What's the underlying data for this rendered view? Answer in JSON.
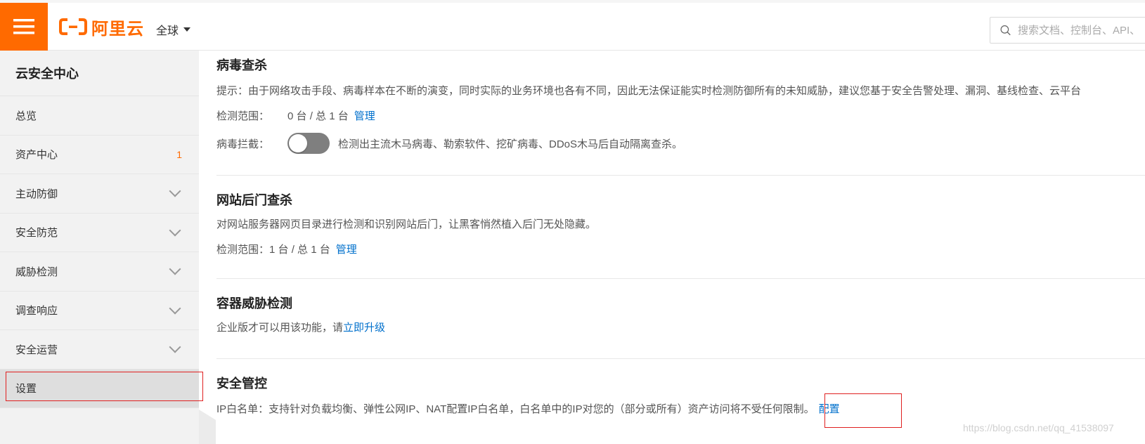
{
  "header": {
    "logo_text": "阿里云",
    "region": "全球",
    "search_placeholder": "搜索文档、控制台、API、"
  },
  "sidebar": {
    "title": "云安全中心",
    "items": [
      {
        "label": "总览",
        "expandable": false
      },
      {
        "label": "资产中心",
        "count": "1",
        "expandable": false
      },
      {
        "label": "主动防御",
        "expandable": true
      },
      {
        "label": "安全防范",
        "expandable": true
      },
      {
        "label": "威胁检测",
        "expandable": true
      },
      {
        "label": "调查响应",
        "expandable": true
      },
      {
        "label": "安全运营",
        "expandable": true
      },
      {
        "label": "设置",
        "expandable": false,
        "active": true
      }
    ]
  },
  "main": {
    "virus": {
      "title": "病毒查杀",
      "tip": "提示：由于网络攻击手段、病毒样本在不断的演变，同时实际的业务环境也各有不同，因此无法保证能实时检测防御所有的未知威胁，建议您基于安全告警处理、漏洞、基线检查、云平台",
      "scope_label": "检测范围：",
      "scope_value": "0 台 / 总 1 台",
      "scope_link": "管理",
      "block_label": "病毒拦截：",
      "block_toggle": "off",
      "block_desc": "检测出主流木马病毒、勒索软件、挖矿病毒、DDoS木马后自动隔离查杀。"
    },
    "webshell": {
      "title": "网站后门查杀",
      "desc": "对网站服务器网页目录进行检测和识别网站后门，让黑客悄然植入后门无处隐藏。",
      "scope_label": "检测范围：",
      "scope_value": "1 台 / 总 1 台",
      "scope_link": "管理"
    },
    "container": {
      "title": "容器威胁检测",
      "desc": "企业版才可以用该功能，请",
      "upgrade_link": "立即升级"
    },
    "security_control": {
      "title": "安全管控",
      "desc": "IP白名单：支持针对负载均衡、弹性公网IP、NAT配置IP白名单，白名单中的IP对您的（部分或所有）资产访问将不受任何限制。",
      "config_link": "配置"
    }
  },
  "watermark": "https://blog.csdn.net/qq_41538097",
  "colors": {
    "brand": "#ff6a00",
    "link": "#0070cc",
    "highlight_box": "#e02020"
  }
}
